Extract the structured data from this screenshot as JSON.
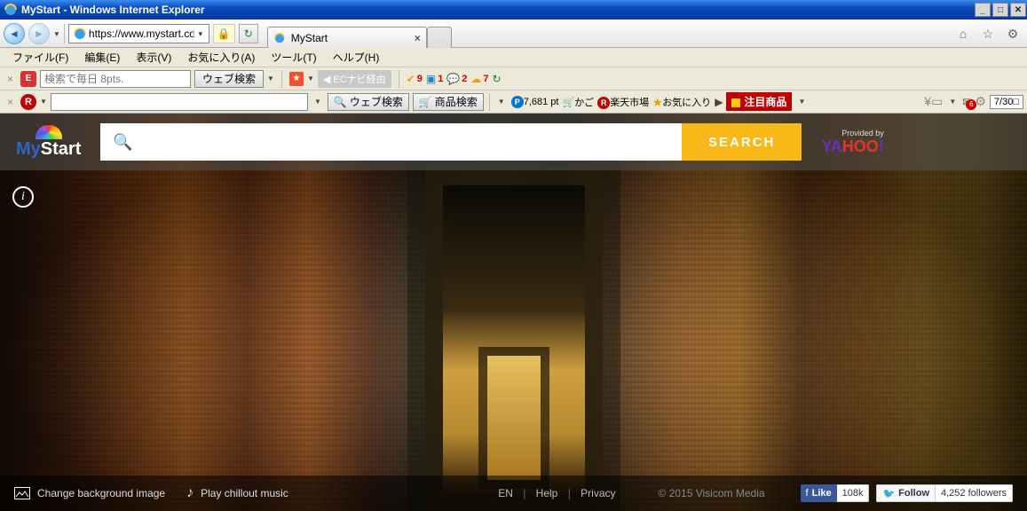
{
  "titlebar": {
    "title": "MyStart - Windows Internet Explorer"
  },
  "address": {
    "url": "https://www.mystart.com/"
  },
  "tab": {
    "title": "MyStart"
  },
  "menubar": {
    "file": "ファイル(F)",
    "edit": "編集(E)",
    "view": "表示(V)",
    "favorites": "お気に入り(A)",
    "tools": "ツール(T)",
    "help": "ヘルプ(H)"
  },
  "tb1": {
    "search_placeholder": "検索で毎日 8pts.",
    "web_search": "ウェブ検索",
    "ecnavi": "ECナビ経由",
    "v_count": "9",
    "box_count": "1",
    "bubble_count": "2",
    "cloud_count": "7"
  },
  "tb2": {
    "web_search": "ウェブ検索",
    "product_search": "商品検索",
    "points": "7,681 pt",
    "cart": "かご",
    "ichiba": "楽天市場",
    "favorites": "お気に入り",
    "hot": "注目商品",
    "mail_count": "6",
    "date": "7/30"
  },
  "page": {
    "logo_my": "My",
    "logo_start": "Start",
    "search_button": "SEARCH",
    "provided": "Provided by",
    "yahoo_ya": "YA",
    "yahoo_hoo": "HOO",
    "yahoo_ex": "!"
  },
  "footer": {
    "change_bg": "Change background image",
    "play_music": "Play chillout music",
    "lang": "EN",
    "help": "Help",
    "privacy": "Privacy",
    "copyright": "© 2015 Visicom Media",
    "fb_like": "Like",
    "fb_count": "108k",
    "tw_follow": "Follow",
    "tw_count": "4,252 followers"
  }
}
